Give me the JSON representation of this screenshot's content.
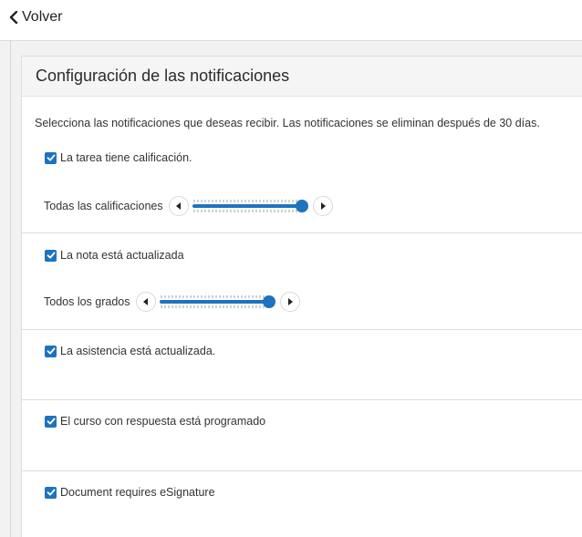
{
  "topbar": {
    "back_label": "Volver"
  },
  "panel": {
    "title": "Configuración de las notificaciones",
    "intro": "Selecciona las notificaciones que deseas recibir. Las notificaciones se eliminan después de 30 días."
  },
  "notifications": [
    {
      "label": "La tarea tiene calificación.",
      "checked": true,
      "slider": {
        "label": "Todas las calificaciones",
        "level": 1.0
      }
    },
    {
      "label": "La nota está actualizada",
      "checked": true,
      "slider": {
        "label": "Todos los grados",
        "level": 1.0
      }
    },
    {
      "label": "La asistencia está actualizada.",
      "checked": true
    },
    {
      "label": "El curso con respuesta está programado",
      "checked": true
    },
    {
      "label": "Document requires eSignature",
      "checked": true
    }
  ],
  "colors": {
    "accent": "#1e73be",
    "panel_header_bg": "#f5f5f5",
    "page_bg": "#f2f2f2"
  },
  "icons": {
    "back": "chevron-left-icon",
    "check": "checkmark-icon",
    "step_left": "caret-left-icon",
    "step_right": "caret-right-icon"
  }
}
